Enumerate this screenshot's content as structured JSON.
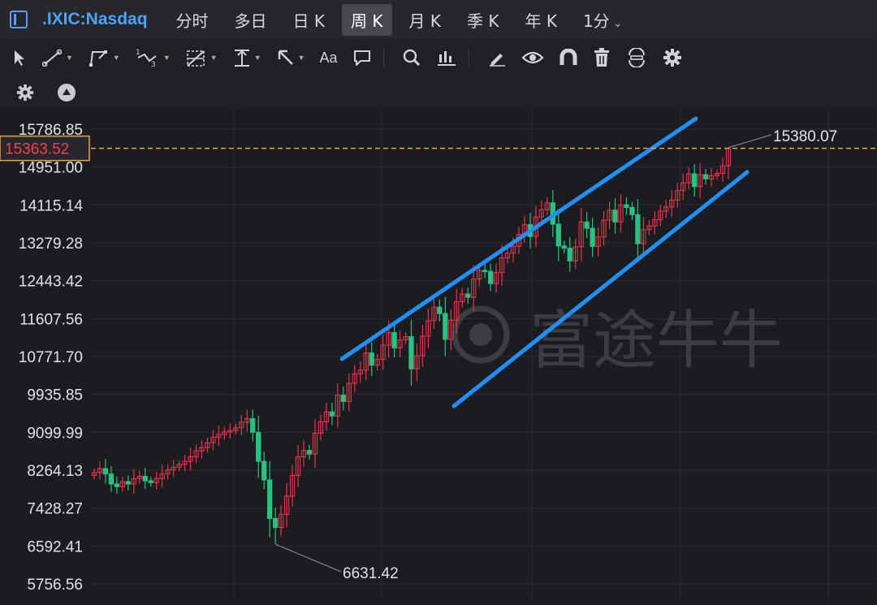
{
  "symbol": ".IXIC:Nasdaq",
  "periods": [
    "分时",
    "多日",
    "日 K",
    "周 K",
    "月 K",
    "季 K",
    "年 K",
    "1分"
  ],
  "active_period": "周 K",
  "toolbar": {
    "tools": [
      "cursor-icon",
      "trend-line-icon",
      "polyline-icon",
      "wave-icon",
      "fib-grid-icon",
      "price-range-icon",
      "arrow-icon",
      "text-icon",
      "comment-icon",
      "zoom-icon",
      "indicator-icon",
      "pen-icon",
      "eye-icon",
      "magnet-icon",
      "trash-icon",
      "sync-icon",
      "settings-icon"
    ],
    "text_tool_label": "Aa"
  },
  "subbar": [
    "settings-icon",
    "triangle-up-icon"
  ],
  "watermark": "富途牛牛",
  "colors": {
    "up": "#e8334c",
    "down": "#27c281",
    "channel": "#1e90ff",
    "current_line": "#f0a03c",
    "symbol": "#4aa3ff"
  },
  "chart_data": {
    "type": "candlestick",
    "y_ticks": [
      15786.85,
      14951.0,
      14115.14,
      13279.28,
      12443.42,
      11607.56,
      10771.7,
      9935.85,
      9099.99,
      8264.13,
      7428.27,
      6592.41,
      5756.56
    ],
    "y_tick_labels": [
      "15786.85",
      "14951.00",
      "14115.14",
      "13279.28",
      "12443.42",
      "11607.56",
      "10771.70",
      "9935.85",
      "9099.99",
      "8264.13",
      "7428.27",
      "6592.41",
      "5756.56"
    ],
    "current_price": "15363.52",
    "high_label": "15380.07",
    "low_label": "6631.42",
    "high_value": 15380.07,
    "low_value": 6631.42,
    "close_path": [
      8210,
      8300,
      8180,
      7960,
      7900,
      8010,
      7960,
      8080,
      8130,
      8030,
      7990,
      8080,
      8180,
      8270,
      8330,
      8390,
      8460,
      8560,
      8690,
      8760,
      8870,
      8990,
      9050,
      9110,
      9140,
      9200,
      9320,
      9400,
      9100,
      8460,
      8050,
      7200,
      7000,
      7290,
      7690,
      8150,
      8560,
      8700,
      8620,
      9080,
      9330,
      9550,
      9460,
      9920,
      9780,
      10180,
      10390,
      10470,
      10850,
      10580,
      10710,
      11020,
      11300,
      10960,
      11140,
      11210,
      10500,
      10790,
      11220,
      11560,
      11860,
      11720,
      11150,
      11570,
      11980,
      12150,
      12080,
      12480,
      12670,
      12650,
      12380,
      12620,
      12950,
      13050,
      13200,
      13470,
      13680,
      13420,
      13850,
      14010,
      14160,
      13690,
      13210,
      13160,
      12880,
      13190,
      13740,
      13600,
      13200,
      13410,
      13780,
      14000,
      13740,
      14120,
      14060,
      13900,
      13260,
      13570,
      13650,
      13790,
      13980,
      14070,
      14220,
      14430,
      14600,
      14800,
      14520,
      14780,
      14690,
      14760,
      14810,
      14980,
      15360
    ]
  }
}
